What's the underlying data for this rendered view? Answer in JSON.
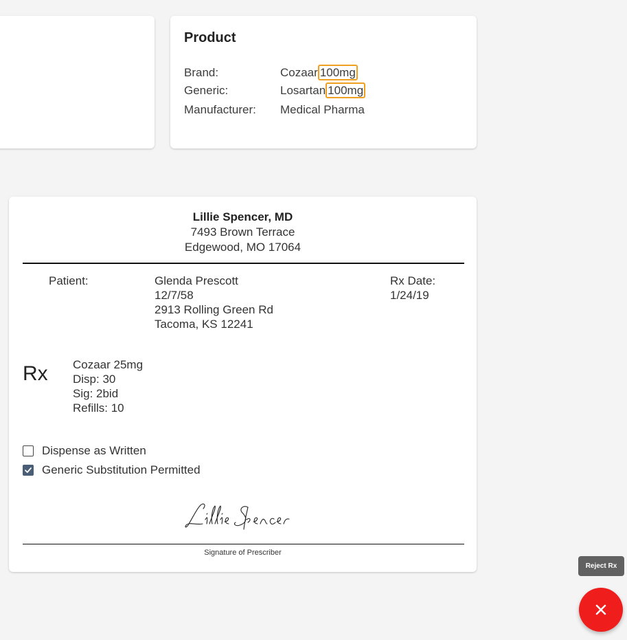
{
  "product": {
    "title": "Product",
    "brand_label": "Brand:",
    "brand_name": "Cozaar",
    "brand_strength": "100mg",
    "generic_label": "Generic:",
    "generic_name": "Losartan",
    "generic_strength": "100mg",
    "manufacturer_label": "Manufacturer:",
    "manufacturer_value": "Medical Pharma",
    "highlight_color": "#f0a020"
  },
  "prescription": {
    "prescriber_name": "Lillie Spencer, MD",
    "prescriber_address_1": "7493 Brown Terrace",
    "prescriber_address_2": "Edgewood, MO 17064",
    "patient_label": "Patient:",
    "patient_name": "Glenda Prescott",
    "patient_dob": "12/7/58",
    "patient_address_1": "2913 Rolling Green Rd",
    "patient_address_2": "Tacoma, KS 12241",
    "rx_date_label": "Rx Date:",
    "rx_date": "1/24/19",
    "rx_symbol": "Rx",
    "drug": "Cozaar 25mg",
    "disp": "Disp: 30",
    "sig": "Sig: 2bid",
    "refills": "Refills: 10",
    "dispense_as_written_label": "Dispense as Written",
    "dispense_as_written_checked": false,
    "generic_substitution_label": "Generic Substitution Permitted",
    "generic_substitution_checked": true,
    "signature_caption": "Signature of Prescriber"
  },
  "actions": {
    "reject_tooltip": "Reject Rx",
    "reject_icon": "close-icon",
    "reject_color": "#f01d1d"
  }
}
